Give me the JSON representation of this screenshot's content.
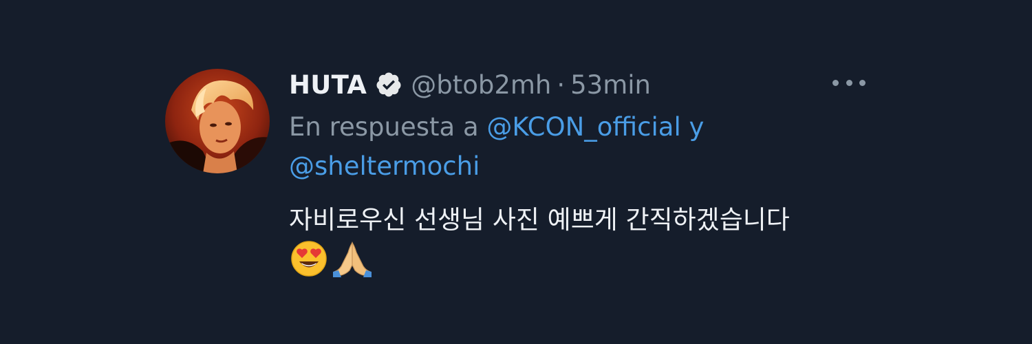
{
  "tweet": {
    "display_name": "HUTA",
    "handle": "@btob2mh",
    "separator": "·",
    "time": "53min",
    "reply_prefix": "En respuesta a",
    "reply_mention_1": "@KCON_official",
    "reply_conjunction": "y",
    "reply_mention_2": "@sheltermochi",
    "text": "자비로우신 선생님 사진 예쁘게 간직하겠습니다",
    "emojis": [
      "heart-eyes-emoji",
      "folded-hands-emoji"
    ]
  },
  "icons": {
    "verified": "verified-badge-icon",
    "more": "more-options-icon"
  },
  "colors": {
    "background": "#151d2b",
    "primary_text": "#eef1f5",
    "secondary_text": "#8b98a5",
    "link": "#4a9de6"
  }
}
